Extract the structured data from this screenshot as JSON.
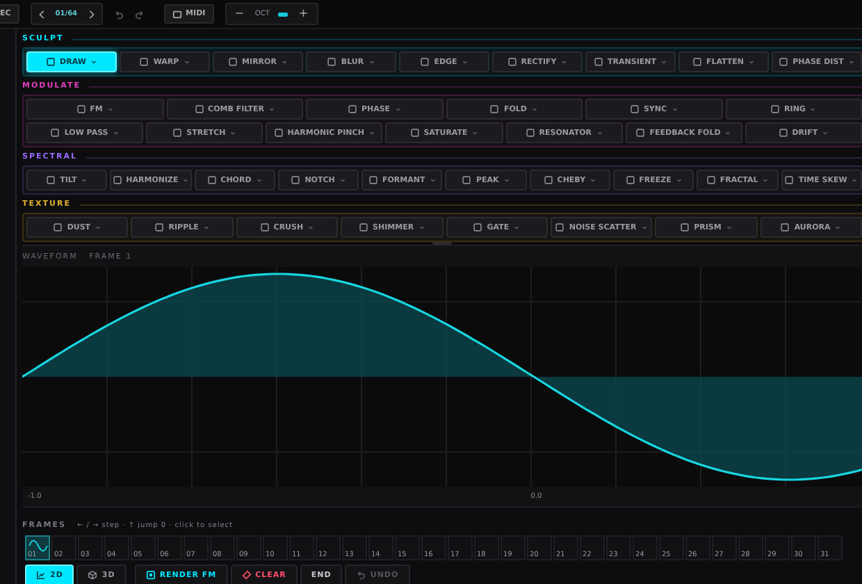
{
  "top_bar": {
    "cut_button": "EC",
    "frame_counter": "01/64",
    "midi_button": "MIDI",
    "octave": {
      "minus": "−",
      "label": "OCT",
      "plus": "+"
    }
  },
  "sections": [
    {
      "title": "SCULPT",
      "color": "#00e5ff",
      "rows": [
        {
          "buttons": [
            {
              "label": "DRAW",
              "selected": true
            },
            {
              "label": "WARP",
              "selected": false
            },
            {
              "label": "MIRROR",
              "selected": false
            },
            {
              "label": "BLUR",
              "selected": false
            },
            {
              "label": "EDGE",
              "selected": false
            },
            {
              "label": "RECTIFY",
              "selected": false
            },
            {
              "label": "TRANSIENT",
              "selected": false
            },
            {
              "label": "FLATTEN",
              "selected": false
            },
            {
              "label": "PHASE DIST",
              "selected": false
            }
          ]
        }
      ]
    },
    {
      "title": "MODULATE",
      "color": "#e040c0",
      "rows": [
        {
          "buttons": [
            {
              "label": "FM",
              "selected": false
            },
            {
              "label": "COMB FILTER",
              "selected": false
            },
            {
              "label": "PHASE",
              "selected": false
            },
            {
              "label": "FOLD",
              "selected": false
            },
            {
              "label": "SYNC",
              "selected": false
            },
            {
              "label": "RING",
              "selected": false
            }
          ]
        },
        {
          "buttons": [
            {
              "label": "LOW PASS",
              "selected": false
            },
            {
              "label": "STRETCH",
              "selected": false
            },
            {
              "label": "HARMONIC PINCH",
              "selected": false
            },
            {
              "label": "SATURATE",
              "selected": false
            },
            {
              "label": "RESONATOR",
              "selected": false
            },
            {
              "label": "FEEDBACK FOLD",
              "selected": false
            },
            {
              "label": "DRIFT",
              "selected": false
            }
          ]
        }
      ]
    },
    {
      "title": "SPECTRAL",
      "color": "#9a6cff",
      "rows": [
        {
          "buttons": [
            {
              "label": "TILT",
              "selected": false
            },
            {
              "label": "HARMONIZE",
              "selected": false
            },
            {
              "label": "CHORD",
              "selected": false
            },
            {
              "label": "NOTCH",
              "selected": false
            },
            {
              "label": "FORMANT",
              "selected": false
            },
            {
              "label": "PEAK",
              "selected": false
            },
            {
              "label": "CHEBY",
              "selected": false
            },
            {
              "label": "FREEZE",
              "selected": false
            },
            {
              "label": "FRACTAL",
              "selected": false
            },
            {
              "label": "TIME SKEW",
              "selected": false
            }
          ]
        }
      ]
    },
    {
      "title": "TEXTURE",
      "color": "#e0b030",
      "rows": [
        {
          "buttons": [
            {
              "label": "DUST",
              "selected": false
            },
            {
              "label": "RIPPLE",
              "selected": false
            },
            {
              "label": "CRUSH",
              "selected": false
            },
            {
              "label": "SHIMMER",
              "selected": false
            },
            {
              "label": "GATE",
              "selected": false
            },
            {
              "label": "NOISE SCATTER",
              "selected": false
            },
            {
              "label": "PRISM",
              "selected": false
            },
            {
              "label": "AURORA",
              "selected": false
            }
          ]
        }
      ]
    }
  ],
  "waveform": {
    "title": "WAVEFORM · FRAME 1",
    "axis_labels": [
      "-1.0",
      "0.0"
    ]
  },
  "frames": {
    "title": "FRAMES",
    "hint": "← / → step · ↑ jump 0 · click to select",
    "items": [
      {
        "label": "01",
        "selected": true
      },
      {
        "label": "02",
        "selected": false
      },
      {
        "label": "03",
        "selected": false
      },
      {
        "label": "04",
        "selected": false
      },
      {
        "label": "05",
        "selected": false
      },
      {
        "label": "06",
        "selected": false
      },
      {
        "label": "07",
        "selected": false
      },
      {
        "label": "08",
        "selected": false
      },
      {
        "label": "09",
        "selected": false
      },
      {
        "label": "10",
        "selected": false
      },
      {
        "label": "11",
        "selected": false
      },
      {
        "label": "12",
        "selected": false
      },
      {
        "label": "13",
        "selected": false
      },
      {
        "label": "14",
        "selected": false
      },
      {
        "label": "15",
        "selected": false
      },
      {
        "label": "16",
        "selected": false
      },
      {
        "label": "17",
        "selected": false
      },
      {
        "label": "18",
        "selected": false
      },
      {
        "label": "19",
        "selected": false
      },
      {
        "label": "20",
        "selected": false
      },
      {
        "label": "21",
        "selected": false
      },
      {
        "label": "22",
        "selected": false
      },
      {
        "label": "23",
        "selected": false
      },
      {
        "label": "24",
        "selected": false
      },
      {
        "label": "25",
        "selected": false
      },
      {
        "label": "26",
        "selected": false
      },
      {
        "label": "27",
        "selected": false
      },
      {
        "label": "28",
        "selected": false
      },
      {
        "label": "29",
        "selected": false
      },
      {
        "label": "30",
        "selected": false
      },
      {
        "label": "31",
        "selected": false
      }
    ]
  },
  "bottom_bar": [
    {
      "kind": "view2d",
      "label": "2D",
      "selected": true
    },
    {
      "kind": "view3d",
      "label": "3D",
      "selected": false
    },
    {
      "kind": "render",
      "label": "RENDER FM",
      "color": "#00e5ff",
      "disabled": false
    },
    {
      "kind": "clear",
      "label": "CLEAR",
      "color": "#ff4d6a",
      "disabled": false
    },
    {
      "kind": "end",
      "label": "END",
      "color": "#c8c8cc",
      "disabled": false
    },
    {
      "kind": "undo",
      "label": "UNDO",
      "disabled": true
    }
  ]
}
